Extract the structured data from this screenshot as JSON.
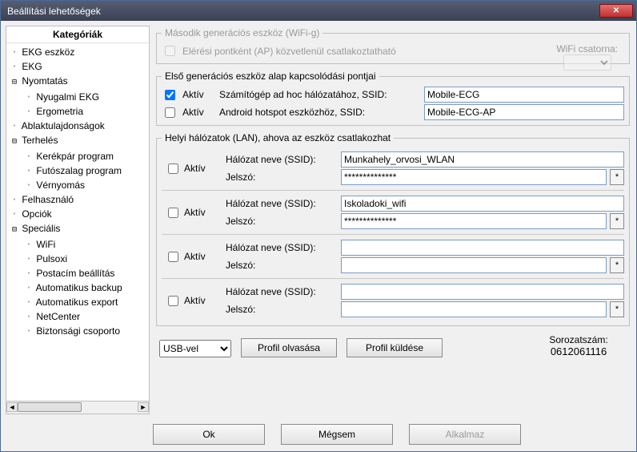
{
  "window": {
    "title": "Beállítási lehetőségek"
  },
  "sidebar": {
    "title": "Kategóriák",
    "items": [
      {
        "label": "EKG eszköz",
        "level": 0,
        "exp": null
      },
      {
        "label": "EKG",
        "level": 0,
        "exp": null
      },
      {
        "label": "Nyomtatás",
        "level": 0,
        "exp": "−"
      },
      {
        "label": "Nyugalmi EKG",
        "level": 1,
        "exp": null
      },
      {
        "label": "Ergometria",
        "level": 1,
        "exp": null
      },
      {
        "label": "Ablaktulajdonságok",
        "level": 0,
        "exp": null
      },
      {
        "label": "Terhelés",
        "level": 0,
        "exp": "−"
      },
      {
        "label": "Kerékpár program",
        "level": 1,
        "exp": null
      },
      {
        "label": "Futószalag program",
        "level": 1,
        "exp": null
      },
      {
        "label": "Vérnyomás",
        "level": 1,
        "exp": null
      },
      {
        "label": "Felhasználó",
        "level": 0,
        "exp": null
      },
      {
        "label": "Opciók",
        "level": 0,
        "exp": null
      },
      {
        "label": "Speciális",
        "level": 0,
        "exp": "−"
      },
      {
        "label": "WiFi",
        "level": 1,
        "exp": null
      },
      {
        "label": "Pulsoxi",
        "level": 1,
        "exp": null
      },
      {
        "label": "Postacím beállítás",
        "level": 1,
        "exp": null
      },
      {
        "label": "Automatikus backup",
        "level": 1,
        "exp": null
      },
      {
        "label": "Automatikus export",
        "level": 1,
        "exp": null
      },
      {
        "label": "NetCenter",
        "level": 1,
        "exp": null
      },
      {
        "label": "Biztonsági csoporto",
        "level": 1,
        "exp": null
      }
    ]
  },
  "gen2": {
    "legend": "Második generációs eszköz (WiFi-g)",
    "ap_label": "Elérési pontként (AP) közvetlenül csatlakoztatható",
    "channel_label": "WiFi csatorna:"
  },
  "gen1": {
    "legend": "Első generációs eszköz alap kapcsolódási pontjai",
    "active_label": "Aktív",
    "adhoc": {
      "label": "Számítógép ad hoc hálózatához, SSID:",
      "value": "Mobile-ECG"
    },
    "hotspot": {
      "label": "Android hotspot eszközhöz, SSID:",
      "value": "Mobile-ECG-AP"
    }
  },
  "lan": {
    "legend": "Helyi hálózatok (LAN), ahova az eszköz csatlakozhat",
    "active_label": "Aktív",
    "ssid_label": "Hálózat neve (SSID):",
    "pass_label": "Jelszó:",
    "networks": [
      {
        "ssid": "Munkahely_orvosi_WLAN",
        "pass": "**************"
      },
      {
        "ssid": "Iskoladoki_wifi",
        "pass": "**************"
      },
      {
        "ssid": "",
        "pass": ""
      },
      {
        "ssid": "",
        "pass": ""
      }
    ]
  },
  "bottom": {
    "conn_option": "USB-vel",
    "read_profile": "Profil olvasása",
    "send_profile": "Profil küldése",
    "serial_label": "Sorozatszám:",
    "serial_value": "0612061116"
  },
  "buttons": {
    "ok": "Ok",
    "cancel": "Mégsem",
    "apply": "Alkalmaz"
  }
}
